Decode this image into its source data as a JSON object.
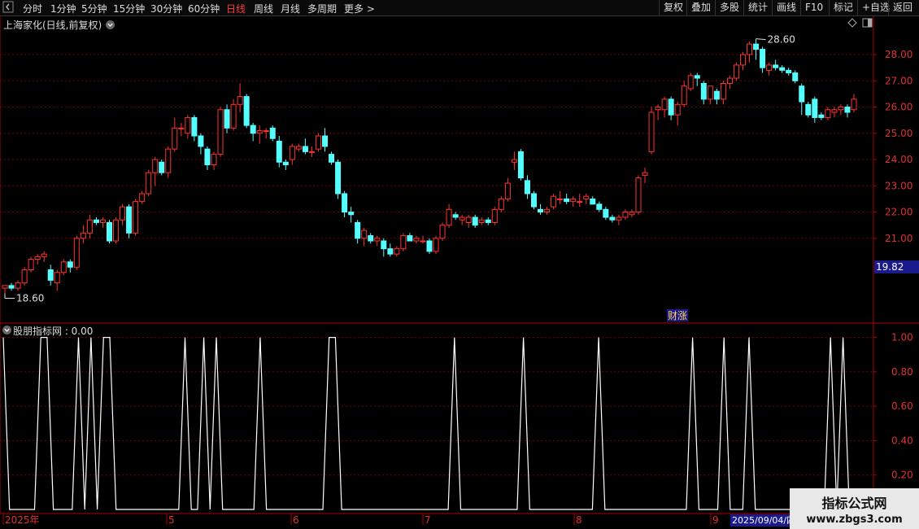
{
  "toolbar": {
    "expand_icon": "arrow-left-icon",
    "periods": [
      "分时",
      "1分钟",
      "5分钟",
      "15分钟",
      "30分钟",
      "60分钟",
      "日线",
      "周线",
      "月线",
      "多周期",
      "更多 >"
    ],
    "active_period": "日线",
    "right_buttons": [
      "复权",
      "叠加",
      "多股",
      "统计",
      "画线",
      "F10",
      "标记",
      "+自选",
      "返回"
    ]
  },
  "main_title": "上海家化(日线,前复权)",
  "indicator_title": "股朋指标网 : 0.00",
  "news_tag": "财涨",
  "date_tag": "2025/09/04/四",
  "high_label": "28.60",
  "low_label": "18.60",
  "price_tag": "19.82",
  "watermark": {
    "line1": "指标公式网",
    "line2": "www.zbgs3.com"
  },
  "colors": {
    "up": "#ff3232",
    "down": "#54ffff",
    "grid": "#7a0000",
    "border": "#b00000",
    "indicator_line": "#ffffff",
    "date_tag_bg": "#1a1a8c"
  },
  "chart_data": [
    {
      "type": "candlestick",
      "title": "上海家化(日线,前复权)",
      "ylim": [
        17.8,
        28.9
      ],
      "y_ticks": [
        "28.00",
        "27.00",
        "26.00",
        "25.00",
        "24.00",
        "23.00",
        "22.00",
        "21.00"
      ],
      "x_ticks": [
        "2025年",
        "5",
        "6",
        "7",
        "8",
        "9"
      ],
      "candles": [
        [
          19.1,
          19.2,
          18.9,
          19.2
        ],
        [
          19.2,
          19.3,
          19.0,
          19.1
        ],
        [
          19.1,
          19.4,
          19.0,
          19.3
        ],
        [
          19.3,
          19.9,
          19.2,
          19.8
        ],
        [
          19.8,
          20.3,
          19.7,
          20.2
        ],
        [
          20.2,
          20.4,
          20.0,
          20.3
        ],
        [
          20.3,
          20.5,
          20.1,
          20.4
        ],
        [
          19.8,
          20.0,
          19.2,
          19.4
        ],
        [
          19.3,
          19.8,
          19.0,
          19.7
        ],
        [
          19.7,
          20.2,
          19.6,
          20.1
        ],
        [
          20.1,
          20.2,
          19.7,
          19.9
        ],
        [
          19.9,
          21.1,
          19.8,
          21.0
        ],
        [
          21.0,
          21.5,
          20.8,
          21.2
        ],
        [
          21.2,
          21.9,
          21.0,
          21.7
        ],
        [
          21.7,
          21.8,
          21.5,
          21.6
        ],
        [
          21.6,
          21.8,
          21.4,
          21.7
        ],
        [
          21.6,
          21.7,
          20.8,
          20.9
        ],
        [
          20.9,
          21.8,
          20.8,
          21.7
        ],
        [
          21.7,
          22.3,
          21.5,
          22.2
        ],
        [
          22.2,
          22.3,
          21.0,
          21.2
        ],
        [
          21.2,
          22.5,
          21.1,
          22.4
        ],
        [
          22.4,
          22.8,
          22.3,
          22.7
        ],
        [
          22.7,
          23.6,
          22.6,
          23.5
        ],
        [
          23.5,
          24.1,
          23.0,
          24.0
        ],
        [
          23.9,
          24.0,
          23.4,
          23.5
        ],
        [
          23.5,
          24.5,
          23.3,
          24.4
        ],
        [
          24.4,
          25.6,
          24.3,
          25.2
        ],
        [
          25.2,
          25.4,
          24.9,
          25.2
        ],
        [
          25.0,
          25.7,
          24.8,
          25.6
        ],
        [
          25.6,
          25.7,
          24.7,
          24.9
        ],
        [
          24.9,
          25.0,
          24.2,
          24.5
        ],
        [
          24.4,
          24.5,
          23.6,
          23.8
        ],
        [
          23.8,
          24.3,
          23.6,
          24.2
        ],
        [
          24.2,
          26.0,
          24.1,
          25.9
        ],
        [
          25.9,
          26.1,
          25.0,
          25.2
        ],
        [
          25.2,
          26.3,
          25.1,
          26.1
        ],
        [
          26.1,
          26.9,
          25.8,
          26.4
        ],
        [
          26.4,
          26.5,
          25.2,
          25.3
        ],
        [
          25.3,
          25.4,
          24.7,
          25.0
        ],
        [
          25.0,
          25.3,
          24.6,
          25.1
        ],
        [
          25.1,
          25.2,
          24.8,
          25.1
        ],
        [
          25.2,
          25.3,
          24.7,
          24.8
        ],
        [
          24.7,
          24.9,
          23.7,
          23.9
        ],
        [
          23.9,
          24.0,
          23.6,
          23.8
        ],
        [
          24.0,
          24.6,
          23.8,
          24.5
        ],
        [
          24.4,
          24.6,
          24.3,
          24.5
        ],
        [
          24.5,
          24.8,
          24.2,
          24.3
        ],
        [
          24.3,
          24.5,
          24.1,
          24.3
        ],
        [
          24.4,
          25.0,
          24.3,
          24.9
        ],
        [
          24.9,
          25.2,
          24.3,
          24.5
        ],
        [
          24.2,
          24.3,
          23.8,
          23.9
        ],
        [
          23.9,
          24.0,
          22.5,
          22.7
        ],
        [
          22.7,
          22.8,
          21.8,
          22.0
        ],
        [
          22.0,
          22.2,
          21.6,
          21.9
        ],
        [
          21.6,
          21.7,
          20.8,
          21.0
        ],
        [
          21.0,
          21.4,
          20.7,
          21.3
        ],
        [
          21.1,
          21.2,
          20.8,
          20.9
        ],
        [
          20.9,
          21.1,
          20.7,
          21.0
        ],
        [
          20.9,
          21.0,
          20.3,
          20.6
        ],
        [
          20.6,
          20.8,
          20.3,
          20.4
        ],
        [
          20.4,
          20.7,
          20.3,
          20.6
        ],
        [
          20.6,
          21.2,
          20.5,
          21.1
        ],
        [
          21.1,
          21.2,
          20.9,
          20.9
        ],
        [
          20.9,
          21.1,
          20.8,
          21.0
        ],
        [
          20.9,
          21.1,
          20.8,
          20.9
        ],
        [
          20.9,
          21.0,
          20.4,
          20.5
        ],
        [
          20.5,
          21.1,
          20.4,
          21.0
        ],
        [
          21.0,
          21.6,
          20.9,
          21.5
        ],
        [
          21.5,
          22.3,
          21.4,
          22.1
        ],
        [
          21.9,
          22.0,
          21.7,
          21.8
        ],
        [
          21.7,
          21.9,
          21.5,
          21.8
        ],
        [
          21.6,
          21.9,
          21.4,
          21.8
        ],
        [
          21.8,
          21.9,
          21.4,
          21.5
        ],
        [
          21.6,
          21.8,
          21.5,
          21.7
        ],
        [
          21.7,
          21.8,
          21.5,
          21.6
        ],
        [
          21.6,
          22.2,
          21.5,
          22.1
        ],
        [
          22.1,
          22.6,
          22.0,
          22.5
        ],
        [
          22.5,
          23.3,
          22.4,
          23.1
        ],
        [
          23.9,
          24.3,
          23.6,
          24.0
        ],
        [
          24.3,
          24.4,
          23.2,
          23.3
        ],
        [
          23.2,
          23.4,
          22.5,
          22.7
        ],
        [
          22.7,
          22.8,
          22.1,
          22.2
        ],
        [
          22.1,
          22.3,
          21.9,
          22.0
        ],
        [
          22.0,
          22.2,
          21.9,
          22.1
        ],
        [
          22.2,
          22.7,
          22.1,
          22.6
        ],
        [
          22.5,
          22.8,
          22.3,
          22.5
        ],
        [
          22.5,
          22.7,
          22.3,
          22.4
        ],
        [
          22.4,
          22.6,
          22.2,
          22.5
        ],
        [
          22.4,
          22.7,
          22.2,
          22.4
        ],
        [
          22.5,
          22.7,
          22.3,
          22.6
        ],
        [
          22.5,
          22.6,
          22.3,
          22.3
        ],
        [
          22.3,
          22.4,
          22.0,
          22.1
        ],
        [
          22.1,
          22.2,
          21.7,
          21.8
        ],
        [
          21.8,
          21.9,
          21.6,
          21.7
        ],
        [
          21.7,
          21.9,
          21.5,
          21.8
        ],
        [
          21.8,
          22.1,
          21.7,
          22.0
        ],
        [
          21.9,
          22.1,
          21.8,
          22.0
        ],
        [
          22.0,
          23.4,
          21.9,
          23.3
        ],
        [
          23.4,
          23.7,
          23.1,
          23.5
        ],
        [
          24.3,
          26.0,
          24.2,
          25.8
        ],
        [
          25.9,
          26.1,
          25.5,
          26.0
        ],
        [
          25.9,
          26.4,
          25.6,
          26.3
        ],
        [
          26.3,
          26.4,
          25.5,
          25.7
        ],
        [
          25.7,
          26.2,
          25.3,
          26.1
        ],
        [
          26.1,
          27.0,
          26.0,
          26.8
        ],
        [
          26.7,
          27.3,
          26.6,
          27.2
        ],
        [
          27.2,
          27.3,
          26.8,
          27.1
        ],
        [
          26.9,
          27.0,
          26.1,
          26.3
        ],
        [
          26.3,
          26.8,
          26.1,
          26.8
        ],
        [
          26.6,
          26.7,
          26.1,
          26.3
        ],
        [
          26.3,
          27.0,
          26.1,
          26.9
        ],
        [
          26.9,
          27.2,
          26.7,
          27.1
        ],
        [
          27.1,
          27.7,
          27.0,
          27.6
        ],
        [
          27.6,
          28.1,
          27.4,
          28.0
        ],
        [
          28.0,
          28.5,
          27.7,
          28.4
        ],
        [
          28.4,
          28.6,
          27.8,
          28.2
        ],
        [
          28.2,
          28.3,
          27.3,
          27.5
        ],
        [
          27.4,
          27.7,
          27.2,
          27.6
        ],
        [
          27.6,
          27.8,
          27.4,
          27.5
        ],
        [
          27.5,
          27.6,
          27.3,
          27.4
        ],
        [
          27.4,
          27.5,
          27.2,
          27.3
        ],
        [
          27.3,
          27.4,
          26.9,
          27.0
        ],
        [
          26.8,
          26.9,
          25.7,
          26.2
        ],
        [
          26.1,
          26.2,
          25.6,
          25.7
        ],
        [
          26.3,
          26.4,
          25.4,
          25.6
        ],
        [
          25.7,
          25.8,
          25.5,
          25.6
        ],
        [
          25.6,
          26.0,
          25.5,
          25.9
        ],
        [
          25.8,
          26.0,
          25.6,
          25.9
        ],
        [
          25.9,
          26.1,
          25.7,
          26.0
        ],
        [
          26.0,
          26.1,
          25.6,
          25.8
        ],
        [
          25.9,
          26.5,
          25.8,
          26.3
        ]
      ]
    },
    {
      "type": "line",
      "title": "股朋指标网",
      "ylim": [
        0,
        1.05
      ],
      "y_ticks": [
        "1.00",
        "0.80",
        "0.60",
        "0.40",
        "0.20"
      ],
      "series": [
        {
          "values": [
            1,
            0,
            0,
            0,
            0,
            0,
            1,
            1,
            0,
            0,
            0,
            0,
            1,
            0,
            1,
            0,
            1,
            1,
            0,
            0,
            0,
            0,
            0,
            0,
            0,
            0,
            0,
            0,
            0,
            1,
            0,
            0,
            1,
            0,
            1,
            0,
            0,
            0,
            0,
            0,
            0,
            1,
            0,
            0,
            0,
            0,
            0,
            0,
            0,
            0,
            0,
            0,
            1,
            1,
            0,
            0,
            0,
            0,
            0,
            0,
            0,
            0,
            0,
            0,
            0,
            0,
            0,
            0,
            0,
            0,
            0,
            0,
            1,
            0,
            0,
            0,
            0,
            0,
            0,
            0,
            0,
            0,
            0,
            1,
            0,
            0,
            0,
            0,
            0,
            0,
            0,
            0,
            0,
            0,
            0,
            1,
            0,
            0,
            0,
            0,
            0,
            0,
            0,
            0,
            0,
            0,
            0,
            0,
            0,
            0,
            1,
            0,
            0,
            0,
            0,
            1,
            0,
            0,
            0,
            1,
            0,
            0,
            0,
            0,
            0,
            0,
            0,
            0,
            0,
            0,
            0,
            0,
            1,
            0,
            1,
            0,
            0
          ]
        }
      ]
    }
  ]
}
